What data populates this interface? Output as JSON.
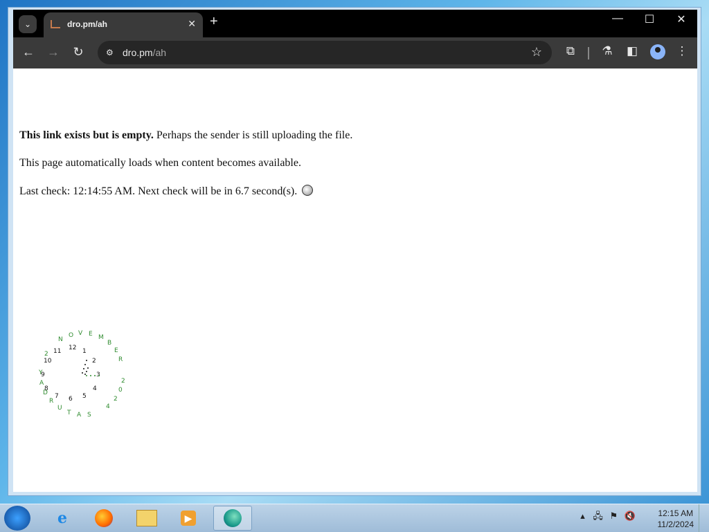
{
  "browser": {
    "tab_title": "dro.pm/ah",
    "url_host": "dro.pm",
    "url_path": "/ah"
  },
  "page": {
    "line1_bold": "This link exists but is empty.",
    "line1_rest": " Perhaps the sender is still uploading the file.",
    "line2": "This page automatically loads when content becomes available.",
    "line3": "Last check: 12:14:55 AM. Next check will be in 6.7 second(s)."
  },
  "clock_widget": {
    "numbers": [
      "12",
      "1",
      "2",
      "3",
      "4",
      "5",
      "6",
      "7",
      "8",
      "9",
      "10",
      "11"
    ],
    "month_letters": [
      "N",
      "O",
      "V",
      "E",
      "M",
      "B",
      "E",
      "R"
    ],
    "day_letters": [
      "S",
      "A",
      "T",
      "U",
      "R",
      "D",
      "A",
      "Y"
    ],
    "year_digits": [
      "2",
      "0",
      "2",
      "4"
    ],
    "day_number": "2"
  },
  "taskbar": {
    "time": "12:15 AM",
    "date": "11/2/2024"
  }
}
